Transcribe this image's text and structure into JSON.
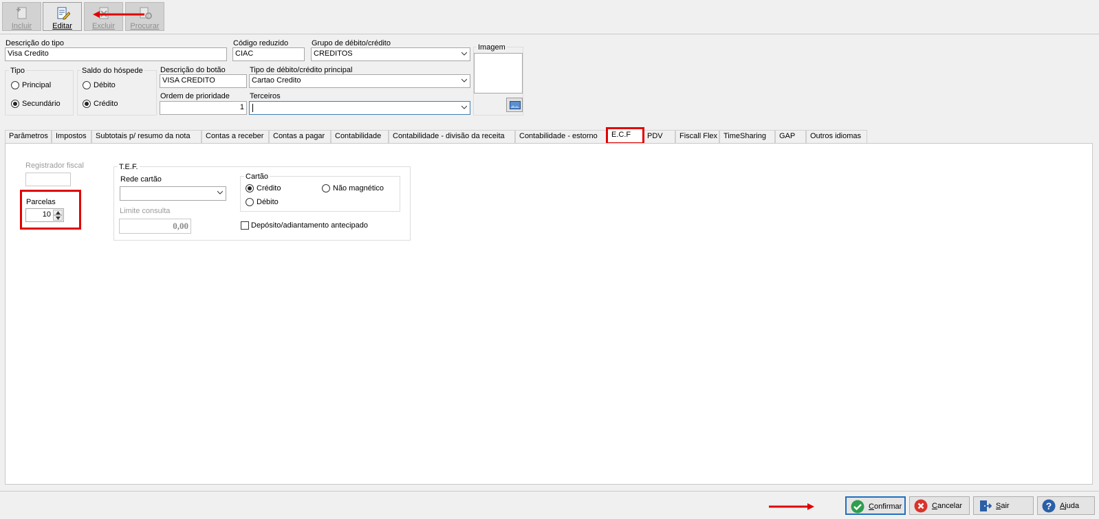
{
  "toolbar": {
    "incluir": "Incluir",
    "editar": "Editar",
    "excluir": "Excluir",
    "procurar": "Procurar"
  },
  "form": {
    "descricao_tipo_label": "Descrição do tipo",
    "descricao_tipo_value": "Visa Credito",
    "codigo_reduzido_label": "Código reduzido",
    "codigo_reduzido_value": "CIAC",
    "grupo_label": "Grupo de débito/crédito",
    "grupo_value": "CREDITOS",
    "imagem_label": "Imagem",
    "tipo_label": "Tipo",
    "tipo_principal": "Principal",
    "tipo_secundario": "Secundário",
    "saldo_label": "Saldo do hóspede",
    "saldo_debito": "Débito",
    "saldo_credito": "Crédito",
    "descricao_botao_label": "Descrição do botão",
    "descricao_botao_value": "VISA CREDITO",
    "tipo_principal_label": "Tipo de débito/crédito principal",
    "tipo_principal_value": "Cartao Credito",
    "ordem_label": "Ordem de prioridade",
    "ordem_value": "1",
    "terceiros_label": "Terceiros",
    "terceiros_value": ""
  },
  "tabs": [
    "Parâmetros",
    "Impostos",
    "Subtotais p/ resumo da nota",
    "Contas a receber",
    "Contas a pagar",
    "Contabilidade",
    "Contabilidade - divisão da receita",
    "Contabilidade - estorno",
    "E.C.F",
    "PDV",
    "Fiscall Flex",
    "TimeSharing",
    "GAP",
    "Outros idiomas"
  ],
  "ecf": {
    "registrador_label": "Registrador fiscal",
    "registrador_value": "",
    "parcelas_label": "Parcelas",
    "parcelas_value": "10",
    "tef_label": "T.E.F.",
    "rede_label": "Rede cartão",
    "rede_value": "",
    "limite_label": "Limite consulta",
    "limite_value": "0,00",
    "cartao_label": "Cartão",
    "credito": "Crédito",
    "debito": "Débito",
    "nao_magnetico": "Não magnético",
    "deposito": "Depósito/adiantamento antecipado"
  },
  "bottom": {
    "confirmar": "Confirmar",
    "cancelar": "Cancelar",
    "sair": "Sair",
    "ajuda": "Ajuda"
  },
  "colors": {
    "annotation_red": "#e00000",
    "confirm_green": "#2e9e4f",
    "cancel_red": "#d9332b",
    "help_blue": "#2a5fa8"
  }
}
